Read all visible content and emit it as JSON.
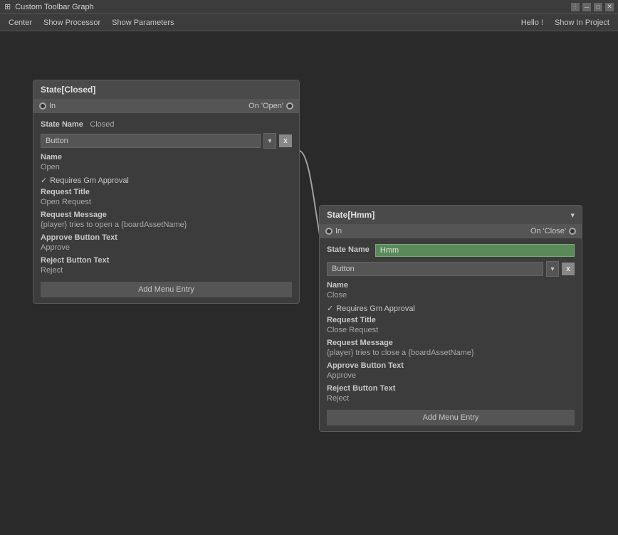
{
  "titleBar": {
    "title": "Custom Toolbar Graph",
    "controls": [
      "menu-icon",
      "minimize",
      "maximize",
      "close"
    ]
  },
  "toolbar": {
    "centerLabel": "Center",
    "showProcessorLabel": "Show Processor",
    "showParametersLabel": "Show Parameters",
    "helloLabel": "Hello !",
    "showInProjectLabel": "Show In Project"
  },
  "nodes": {
    "closed": {
      "title": "State[Closed]",
      "portIn": "In",
      "portOut": "On 'Open'",
      "stateNameLabel": "State Name",
      "stateNameValue": "Closed",
      "selectorLabel": "Button",
      "nameLabel": "Name",
      "nameValue": "Open",
      "requiresLabel": "Requires Gm Approval",
      "requiresChecked": true,
      "requestTitleLabel": "Request Title",
      "requestTitleValue": "Open Request",
      "requestMessageLabel": "Request Message",
      "requestMessageValue": "{player} tries to open a {boardAssetName}",
      "approveButtonLabel": "Approve Button Text",
      "approveButtonValue": "Approve",
      "rejectButtonLabel": "Reject Button Text",
      "rejectButtonValue": "Reject",
      "addMenuEntryLabel": "Add Menu Entry"
    },
    "hmm": {
      "title": "State[Hmm]",
      "dropdownArrow": "▾",
      "portIn": "In",
      "portOut": "On 'Close'",
      "stateNameLabel": "State Name",
      "stateNameValue": "Hmm",
      "stateNamePlaceholder": "Hmm",
      "selectorLabel": "Button",
      "nameLabel": "Name",
      "nameValue": "Close",
      "requiresLabel": "Requires Gm Approval",
      "requiresChecked": true,
      "requestTitleLabel": "Request Title",
      "requestTitleValue": "Close Request",
      "requestMessageLabel": "Request Message",
      "requestMessageValue": "{player} tries to close a {boardAssetName}",
      "approveButtonLabel": "Approve Button Text",
      "approveButtonValue": "Approve",
      "rejectButtonLabel": "Reject Button Text",
      "rejectButtonValue": "Reject",
      "addMenuEntryLabel": "Add Menu Entry"
    }
  },
  "icons": {
    "checkmark": "✓",
    "close": "x",
    "dropdownArrow": "▾",
    "menuDots": "⋮",
    "minimize": "─",
    "maximize": "□",
    "closeWindow": "✕"
  },
  "colors": {
    "accent": "#5a8a5a",
    "nodeBackground": "#3c3c3c",
    "portBackground": "#555555",
    "connectionLine": "#a0a0a0"
  }
}
